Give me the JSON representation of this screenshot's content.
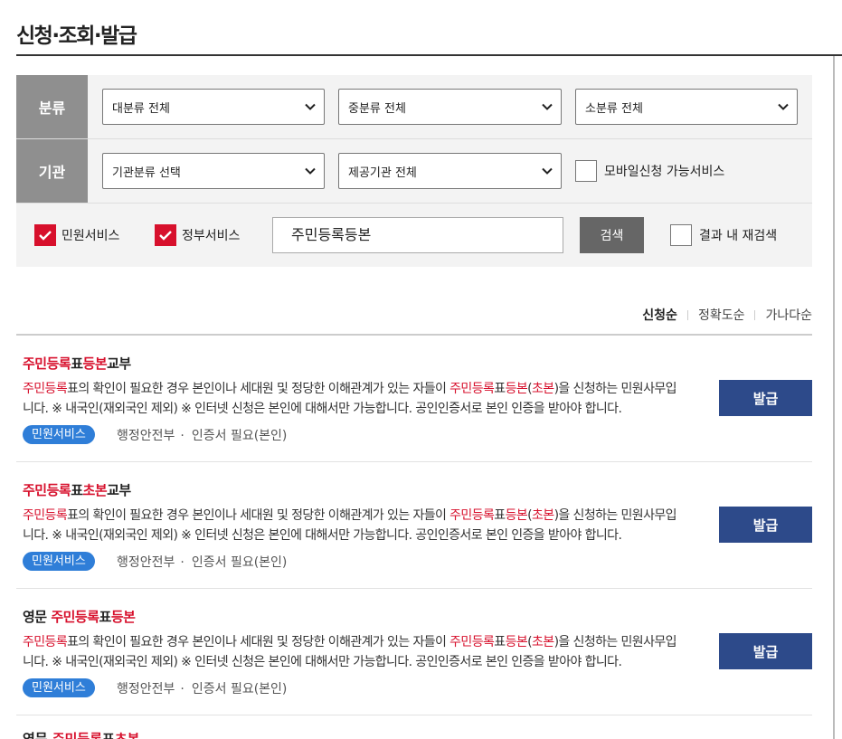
{
  "page": {
    "title": "신청·조회·발급"
  },
  "filters": {
    "category_label": "분류",
    "agency_label": "기관",
    "major_category": "대분류 전체",
    "middle_category": "중분류 전체",
    "minor_category": "소분류 전체",
    "agency_type": "기관분류 선택",
    "provider_agency": "제공기관 전체",
    "mobile_only_label": "모바일신청 가능서비스",
    "mobile_only_checked": false,
    "civil_service_label": "민원서비스",
    "civil_service_checked": true,
    "gov_service_label": "정부서비스",
    "gov_service_checked": true
  },
  "search": {
    "value": "주민등록등본",
    "button_label": "검색",
    "within_results_label": "결과 내 재검색",
    "within_results_checked": false
  },
  "sort": {
    "options": [
      "신청순",
      "정확도순",
      "가나다순"
    ],
    "active": "신청순"
  },
  "results": [
    {
      "title_parts": [
        {
          "text": "주민등록",
          "hl": true
        },
        {
          "text": "표",
          "hl": false
        },
        {
          "text": "등본",
          "hl": true
        },
        {
          "text": "교부",
          "hl": false
        }
      ],
      "desc_parts": [
        {
          "text": "주민등록",
          "hl": true
        },
        {
          "text": "표의 확인이 필요한 경우 본인이나 세대원 및 정당한 이해관계가 있는 자들이 ",
          "hl": false
        },
        {
          "text": "주민등록",
          "hl": true
        },
        {
          "text": "표",
          "hl": false
        },
        {
          "text": "등본",
          "hl": true
        },
        {
          "text": "(",
          "hl": false
        },
        {
          "text": "초본",
          "hl": true
        },
        {
          "text": ")을 신청하는 민원사무입니다. ※ 내국인(재외국인 제외) ※ 인터넷 신청은 본인에 대해서만 가능합니다. 공인인증서로 본인 인증을 받아야 합니다.",
          "hl": false
        }
      ],
      "badge": "민원서비스",
      "agency": "행정안전부",
      "cert": "인증서 필요(본인)",
      "button": "발급"
    },
    {
      "title_parts": [
        {
          "text": "주민등록",
          "hl": true
        },
        {
          "text": "표",
          "hl": false
        },
        {
          "text": "초본",
          "hl": true
        },
        {
          "text": "교부",
          "hl": false
        }
      ],
      "desc_parts": [
        {
          "text": "주민등록",
          "hl": true
        },
        {
          "text": "표의 확인이 필요한 경우 본인이나 세대원 및 정당한 이해관계가 있는 자들이 ",
          "hl": false
        },
        {
          "text": "주민등록",
          "hl": true
        },
        {
          "text": "표",
          "hl": false
        },
        {
          "text": "등본",
          "hl": true
        },
        {
          "text": "(",
          "hl": false
        },
        {
          "text": "초본",
          "hl": true
        },
        {
          "text": ")을 신청하는 민원사무입니다. ※ 내국인(재외국인 제외) ※ 인터넷 신청은 본인에 대해서만 가능합니다. 공인인증서로 본인 인증을 받아야 합니다.",
          "hl": false
        }
      ],
      "badge": "민원서비스",
      "agency": "행정안전부",
      "cert": "인증서 필요(본인)",
      "button": "발급"
    },
    {
      "title_parts": [
        {
          "text": "영문 ",
          "hl": false
        },
        {
          "text": "주민등록",
          "hl": true
        },
        {
          "text": "표",
          "hl": false
        },
        {
          "text": "등본",
          "hl": true
        }
      ],
      "desc_parts": [
        {
          "text": "주민등록",
          "hl": true
        },
        {
          "text": "표의 확인이 필요한 경우 본인이나 세대원 및 정당한 이해관계가 있는 자들이 ",
          "hl": false
        },
        {
          "text": "주민등록",
          "hl": true
        },
        {
          "text": "표",
          "hl": false
        },
        {
          "text": "등본",
          "hl": true
        },
        {
          "text": "(",
          "hl": false
        },
        {
          "text": "초본",
          "hl": true
        },
        {
          "text": ")을 신청하는 민원사무입니다. ※ 내국인(재외국인 제외) ※ 인터넷 신청은 본인에 대해서만 가능합니다. 공인인증서로 본인 인증을 받아야 합니다.",
          "hl": false
        }
      ],
      "badge": "민원서비스",
      "agency": "행정안전부",
      "cert": "인증서 필요(본인)",
      "button": "발급"
    }
  ],
  "partial_next_title_parts": [
    {
      "text": "영문 ",
      "hl": false
    },
    {
      "text": "주민등록",
      "hl": true
    },
    {
      "text": "표",
      "hl": false
    },
    {
      "text": "초본",
      "hl": true
    }
  ],
  "colors": {
    "highlight": "#d7102c",
    "issue_button": "#2d4a8a",
    "badge": "#2f7ed8",
    "filter_label_bg": "#8f8f8f"
  }
}
